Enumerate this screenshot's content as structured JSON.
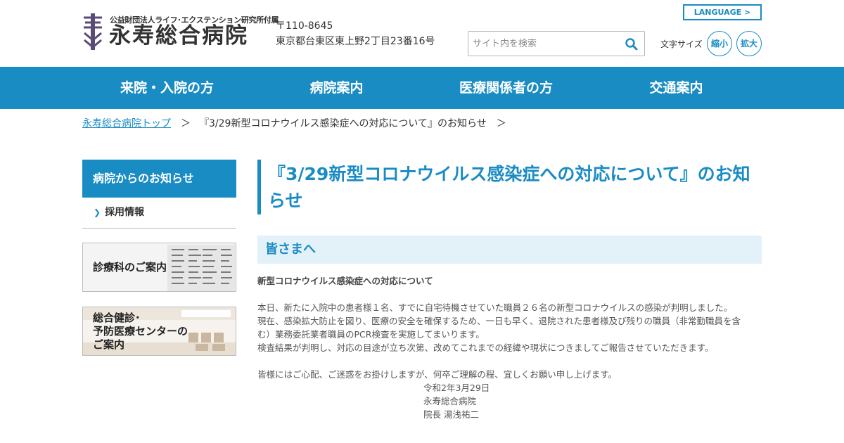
{
  "header": {
    "logo_sub": "公益財団法人ライフ･エクステンション研究所付属",
    "logo_main": "永寿総合病院",
    "postal": "〒110-8645",
    "address": "東京都台東区東上野2丁目23番16号",
    "language_label": "LANGUAGE >",
    "search_placeholder": "サイト内を検索",
    "fontsize_label": "文字サイズ",
    "shrink_label": "縮小",
    "enlarge_label": "拡大",
    "icons": [
      "logo-mark-icon",
      "search-icon"
    ]
  },
  "nav": {
    "items": [
      {
        "label": "来院・入院の方"
      },
      {
        "label": "病院案内"
      },
      {
        "label": "医療関係者の方"
      },
      {
        "label": "交通案内"
      }
    ]
  },
  "breadcrumb": {
    "home": "永寿総合病院トップ",
    "sep": "＞",
    "current": "『3/29新型コロナウイルス感染症への対応について』のお知らせ"
  },
  "sidebar": {
    "heading": "病院からのお知らせ",
    "items": [
      {
        "label": "採用情報"
      }
    ],
    "banners": [
      {
        "label": "診療科のご案内"
      },
      {
        "line1": "総合健診･",
        "line2": "予防医療センターの",
        "line3": "ご案内"
      }
    ]
  },
  "main": {
    "title": "『3/29新型コロナウイルス感染症への対応について』のお知らせ",
    "section_heading": "皆さまへ",
    "paragraphs": [
      "新型コロナウイルス感染症への対応について",
      "本日、新たに入院中の患者様１名、すでに自宅待機させていた職員２６名の新型コロナウイルスの感染が判明しました。",
      "現在、感染拡大防止を図り、医療の安全を確保するため、一日も早く、退院された患者様及び残りの職員（非常勤職員を含",
      "む）業務委託業者職員のPCR検査を実施してまいります。",
      "検査結果が判明し、対応の目途が立ち次第、改めてこれまでの経緯や現状につきましてご報告させていただきます。",
      "皆様にはご心配、ご迷惑をお掛けしますが、何卒ご理解の程、宜しくお願い申し上げます。"
    ],
    "signature": {
      "date": "令和2年3月29日",
      "org": "永寿総合病院",
      "person": "院長 湯浅祐二"
    }
  },
  "colors": {
    "primary": "#1a8cc4",
    "section_bg": "#e3f1f9",
    "text": "#333333"
  }
}
